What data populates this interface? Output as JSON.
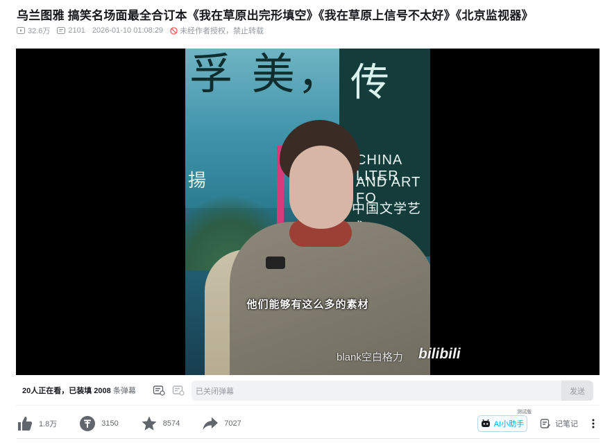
{
  "video": {
    "title": "乌兰图雅 搞笑名场面最全合订本《我在草原出完形填空》《我在草原上信号不太好》《北京监视器》",
    "views": "32.6万",
    "danmaku_count": "2101",
    "publish_time": "2026-01-10 01:08:29",
    "copyright_notice": "未经作者授权，禁止转载"
  },
  "player": {
    "subtitle": "他们能够有这么多的素材",
    "watermark_text": "blank空白格力",
    "watermark_logo": "bilibili",
    "scene_text_1": "孚 美，",
    "scene_text_2": "传",
    "scene_text_3": "CHINA LITER",
    "scene_text_4": "AND ART FO",
    "scene_text_5": "中国文学艺术",
    "scene_text_6": "揚"
  },
  "danmaku_bar": {
    "watching_prefix": "20人正在看，已装填 ",
    "loaded_count": "2008",
    "watching_suffix": " 条弹幕",
    "input_placeholder": "已关闭弹幕",
    "send_label": "发送"
  },
  "toolbar": {
    "like_count": "1.8万",
    "coin_count": "3150",
    "favorite_count": "8574",
    "share_count": "7027",
    "ai_label": "AI小助手",
    "ai_badge": "测试版",
    "note_label": "记笔记"
  },
  "colors": {
    "accent": "#00aeec",
    "text_primary": "#18191c",
    "text_secondary": "#61666d",
    "text_muted": "#9499a0",
    "warn": "#f25d59"
  }
}
